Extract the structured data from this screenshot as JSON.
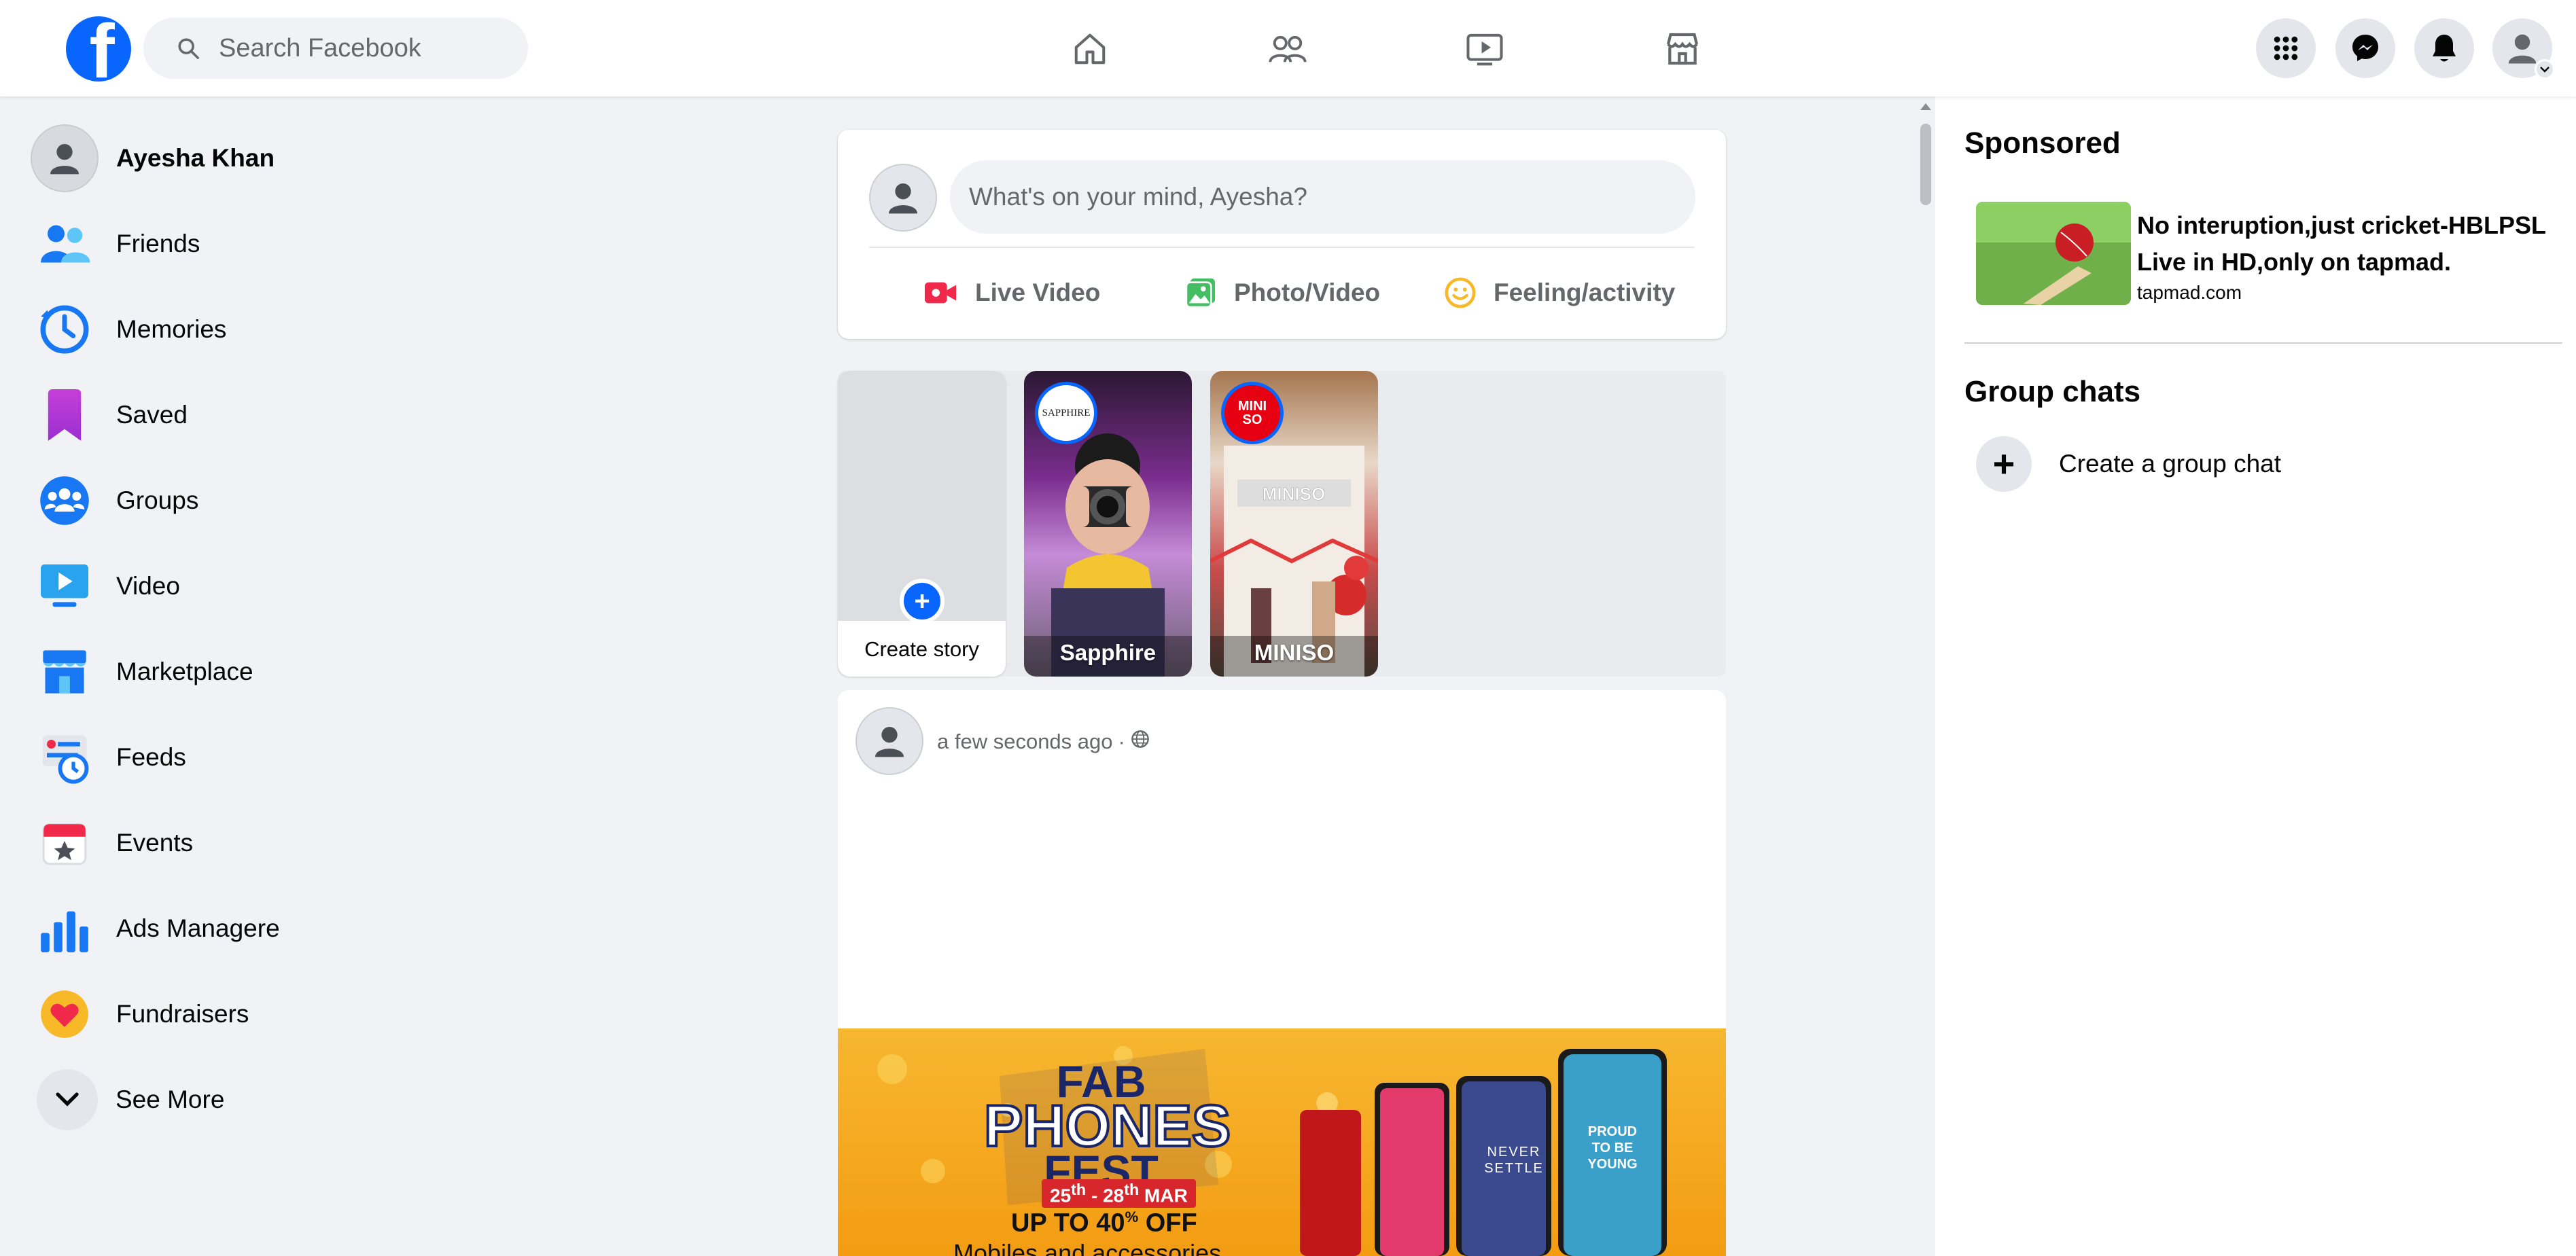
{
  "topbar": {
    "logo": "f",
    "search_placeholder": "Search Facebook",
    "nav_icons": [
      "home-icon",
      "friends-icon",
      "watch-icon",
      "marketplace-icon"
    ],
    "right_icons": [
      "menu-grid-icon",
      "messenger-icon",
      "notifications-bell-icon",
      "account-icon"
    ]
  },
  "sidebar": {
    "user_name": "Ayesha Khan",
    "items": [
      {
        "label": "Friends",
        "icon": "friends-icon"
      },
      {
        "label": "Memories",
        "icon": "memories-clock-icon"
      },
      {
        "label": "Saved",
        "icon": "bookmark-icon"
      },
      {
        "label": "Groups",
        "icon": "groups-icon"
      },
      {
        "label": "Video",
        "icon": "video-icon"
      },
      {
        "label": "Marketplace",
        "icon": "marketplace-icon"
      },
      {
        "label": "Feeds",
        "icon": "feeds-icon"
      },
      {
        "label": "Events",
        "icon": "events-calendar-icon"
      },
      {
        "label": "Ads Managere",
        "icon": "ads-chart-icon"
      },
      {
        "label": "Fundraisers",
        "icon": "fundraiser-heart-icon"
      }
    ],
    "see_more": "See More"
  },
  "composer": {
    "placeholder": "What's on your mind, Ayesha?",
    "actions": [
      {
        "label": "Live Video",
        "color": "#f02849"
      },
      {
        "label": "Photo/Video",
        "color": "#45bd62"
      },
      {
        "label": "Feeling/activity",
        "color": "#f7b928"
      }
    ]
  },
  "stories": {
    "create_label": "Create story",
    "create_plus": "+",
    "items": [
      {
        "name": "Sapphire",
        "badge_text": "SAPPHIRE"
      },
      {
        "name": "MINISO",
        "badge_text": "MINI SO"
      }
    ]
  },
  "post": {
    "timestamp": "a few seconds ago",
    "separator": "·",
    "banner": {
      "line1": "FAB",
      "line2": "PHONES",
      "line3": "FEST",
      "dates_text": "25",
      "dates_sup1": "th",
      "dates_mid": " - 28",
      "dates_sup2": "th",
      "dates_month": " MAR",
      "offer": "UP TO 40% OFF",
      "offer_pre": "UP TO 40",
      "offer_sup": "%",
      "offer_post": " OFF",
      "subtext": "Mobiles and accessories",
      "phone_texts": [
        "NEVER SETTLE",
        "PROUD TO BE YOUNG"
      ]
    }
  },
  "right": {
    "sponsored_title": "Sponsored",
    "ad_title": "No interuption,just cricket-HBLPSL Live in HD,only on tapmad.",
    "ad_url": "tapmad.com",
    "group_chats_title": "Group chats",
    "create_group_chat": "Create a group chat",
    "create_group_plus": "+"
  },
  "colors": {
    "brand_blue": "#0866ff",
    "background": "#f0f2f5"
  }
}
